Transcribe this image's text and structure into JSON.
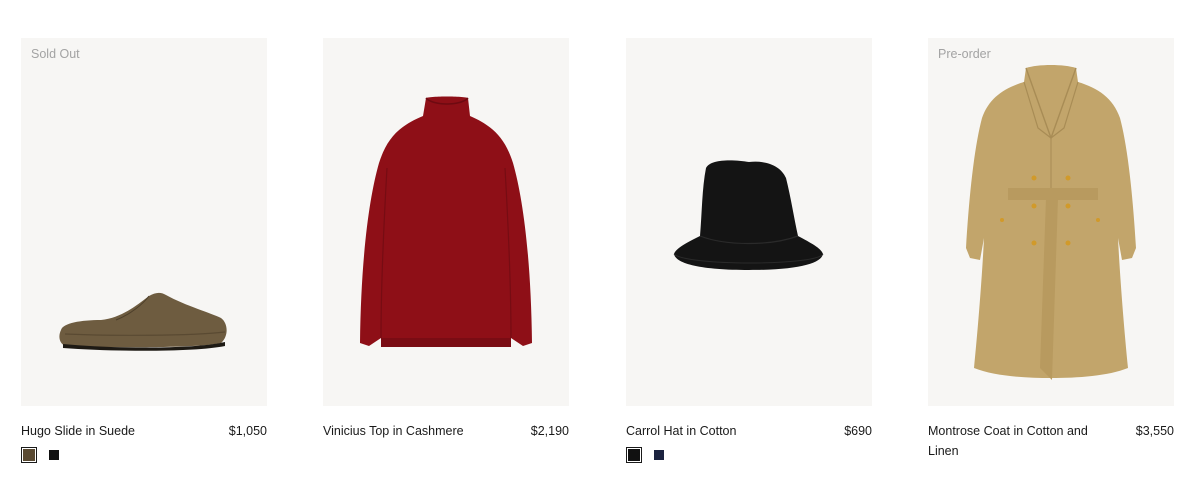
{
  "products": [
    {
      "badge": "Sold Out",
      "name": "Hugo Slide in Suede",
      "price": "$1,050",
      "swatches": [
        {
          "color": "#5a4a32",
          "selected": true
        },
        {
          "color": "#111111",
          "selected": false
        }
      ]
    },
    {
      "badge": "",
      "name": "Vinicius Top in Cashmere",
      "price": "$2,190",
      "swatches": []
    },
    {
      "badge": "",
      "name": "Carrol Hat in Cotton",
      "price": "$690",
      "swatches": [
        {
          "color": "#111111",
          "selected": true
        },
        {
          "color": "#1c2340",
          "selected": false
        }
      ]
    },
    {
      "badge": "Pre-order",
      "name": "Montrose Coat in Cotton and Linen",
      "price": "$3,550",
      "swatches": []
    }
  ],
  "icons": {
    "shoe": "slide-shoe-image",
    "sweater": "turtleneck-sweater-image",
    "hat": "bucket-hat-image",
    "coat": "trench-coat-image"
  },
  "colors": {
    "image_bg": "#f7f6f4",
    "badge_text": "#a3a3a3"
  }
}
